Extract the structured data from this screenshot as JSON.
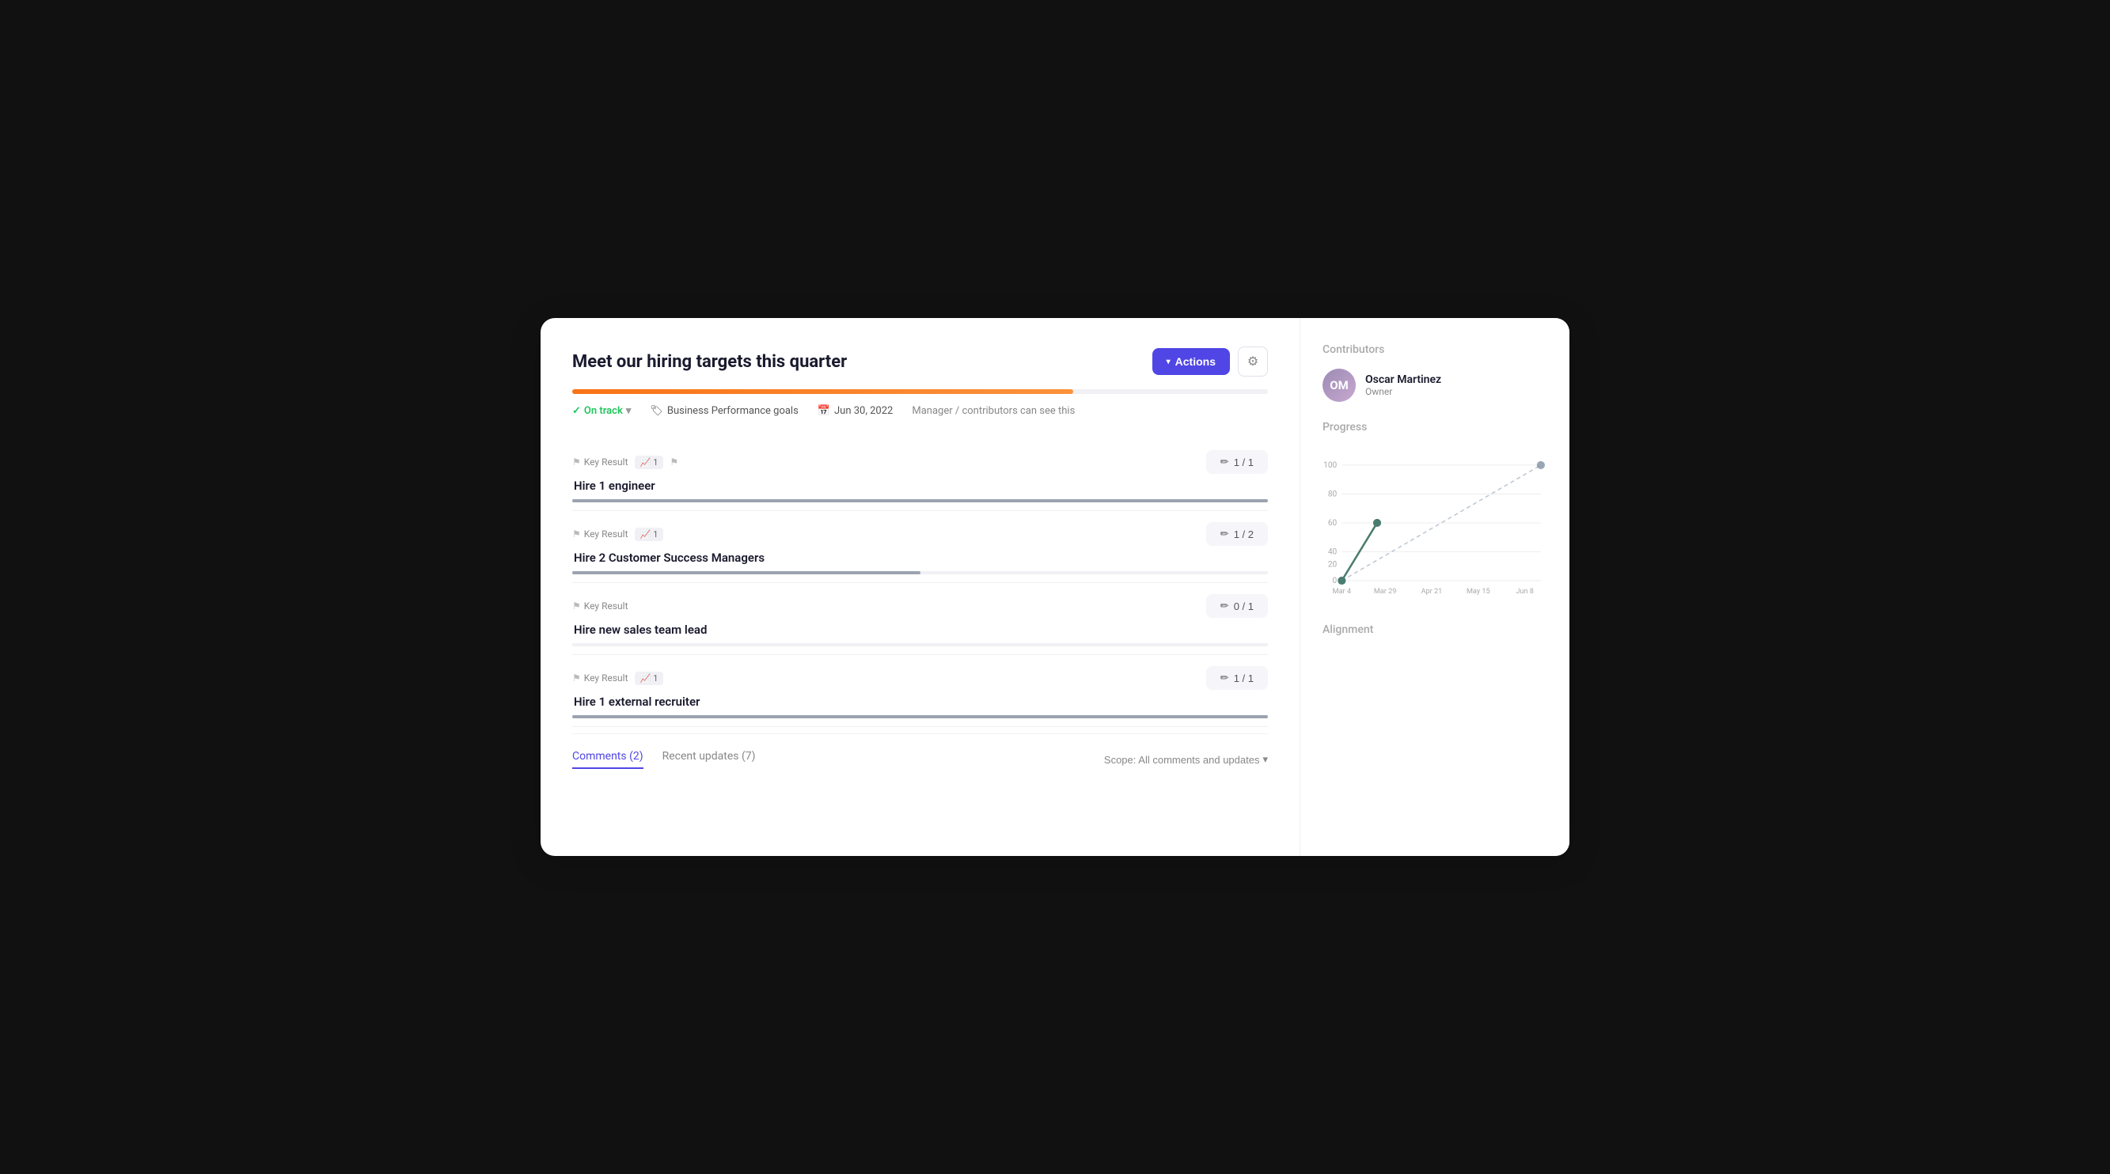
{
  "page": {
    "background": "#111"
  },
  "header": {
    "title": "Meet our hiring targets this quarter",
    "actions_label": "Actions",
    "gear_icon": "⚙"
  },
  "progress": {
    "fill_percent": 72
  },
  "meta": {
    "status": "On track",
    "tag": "Business Performance goals",
    "date": "Jun 30, 2022",
    "visibility": "Manager / contributors can see this"
  },
  "key_results": [
    {
      "label": "Key Result",
      "badge_value": "1",
      "has_flag": true,
      "title": "Hire 1 engineer",
      "progress_text": "1 / 1",
      "progress_fill": 100
    },
    {
      "label": "Key Result",
      "badge_value": "1",
      "has_flag": false,
      "title": "Hire 2 Customer Success Managers",
      "progress_text": "1 / 2",
      "progress_fill": 50
    },
    {
      "label": "Key Result",
      "badge_value": null,
      "has_flag": false,
      "title": "Hire new sales team lead",
      "progress_text": "0 / 1",
      "progress_fill": 0
    },
    {
      "label": "Key Result",
      "badge_value": "1",
      "has_flag": false,
      "title": "Hire 1 external recruiter",
      "progress_text": "1 / 1",
      "progress_fill": 100
    }
  ],
  "tabs": {
    "items": [
      {
        "label": "Comments (2)",
        "active": true
      },
      {
        "label": "Recent updates (7)",
        "active": false
      }
    ],
    "scope_label": "Scope: All comments and updates"
  },
  "sidebar": {
    "contributors_label": "Contributors",
    "contributor_name": "Oscar Martinez",
    "contributor_role": "Owner",
    "progress_label": "Progress",
    "alignment_label": "Alignment",
    "chart": {
      "x_labels": [
        "Mar 4",
        "Mar 29",
        "Apr 21",
        "May 15",
        "Jun 8"
      ],
      "y_labels": [
        "0",
        "20",
        "40",
        "60",
        "80",
        "100"
      ],
      "actual_points": [
        [
          0,
          0
        ],
        [
          30,
          60
        ]
      ],
      "target_points": [
        [
          0,
          0
        ],
        [
          240,
          100
        ]
      ]
    }
  },
  "icons": {
    "check": "✓",
    "chevron_down": "▾",
    "tag": "🏷",
    "calendar": "📅",
    "pencil": "✏",
    "flag": "⚑",
    "chart": "📈"
  }
}
